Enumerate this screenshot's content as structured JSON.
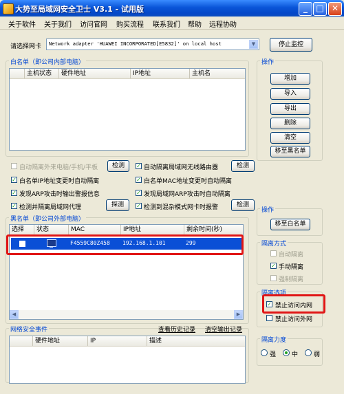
{
  "window": {
    "title": "大势至局域网安全卫士 V3.1 - 试用版",
    "min": "_",
    "max": "□",
    "close": "✕"
  },
  "menu": [
    "关于软件",
    "关于我们",
    "访问官网",
    "购买流程",
    "联系我们",
    "帮助",
    "远程协助"
  ],
  "nic": {
    "label": "请选择网卡",
    "value": "Network adapter 'HUAWEI INCORPORATED[E5832]' on local host",
    "stop_button": "停止监控"
  },
  "whitelist": {
    "title": "白名单（即公司内部电脑）",
    "columns": [
      "主机状态",
      "硬件地址",
      "IP地址",
      "主机名"
    ]
  },
  "actions1": {
    "title": "操作",
    "buttons": [
      "增加",
      "导入",
      "导出",
      "删除",
      "清空",
      "移至黑名单"
    ]
  },
  "options": {
    "opt1": {
      "label": "自动隔离外来电脑/手机/平板",
      "checked": false,
      "disabled": true
    },
    "detect1": "检测",
    "opt2": {
      "label": "自动隔离局域网无线路由器",
      "checked": true
    },
    "detect2": "检测",
    "opt3": {
      "label": "白名单IP地址变更时自动隔离",
      "checked": true
    },
    "opt4": {
      "label": "白名单MAC地址变更时自动隔离",
      "checked": true
    },
    "opt5": {
      "label": "发现ARP攻击时输出警报信息",
      "checked": true
    },
    "opt6": {
      "label": "发现局域网ARP攻击时自动隔离",
      "checked": true
    },
    "opt7": {
      "label": "检测并隔离局域网代理",
      "checked": true
    },
    "probe": "探测",
    "opt8": {
      "label": "检测到混杂模式网卡时报警",
      "checked": true
    },
    "detect3": "检测"
  },
  "blacklist": {
    "title": "黑名单（即公司外部电脑）",
    "columns": [
      "选择",
      "状态",
      "MAC",
      "IP地址",
      "剩余时间(秒)"
    ],
    "rows": [
      {
        "selected": false,
        "status": "computer-icon",
        "mac": "F4559C80Z458",
        "ip": "192.168.1.101",
        "remaining": "299"
      }
    ]
  },
  "actions2": {
    "title": "操作",
    "move_to_whitelist": "移至白名单"
  },
  "isolation_mode": {
    "title": "隔离方式",
    "auto": {
      "label": "自动隔离",
      "checked": false
    },
    "manual": {
      "label": "手动隔离",
      "checked": true
    },
    "force": {
      "label": "强制隔离",
      "checked": false
    }
  },
  "isolation_options": {
    "title": "隔离选项",
    "block_intranet": {
      "label": "禁止访问内网",
      "checked": true
    },
    "block_internet": {
      "label": "禁止访问外网",
      "checked": false
    }
  },
  "isolation_strength": {
    "title": "隔离力度",
    "options": [
      "强",
      "中",
      "弱"
    ],
    "selected": "中"
  },
  "events": {
    "title": "网络安全事件",
    "view_history": "查看历史记录",
    "clear_output": "清空输出记录",
    "columns": [
      "硬件地址",
      "IP",
      "描述"
    ]
  },
  "colors": {
    "title_bar": "#0A55D8",
    "group_label": "#0046D5",
    "selected_row": "#0A4FD6",
    "highlight": "#E01515"
  }
}
